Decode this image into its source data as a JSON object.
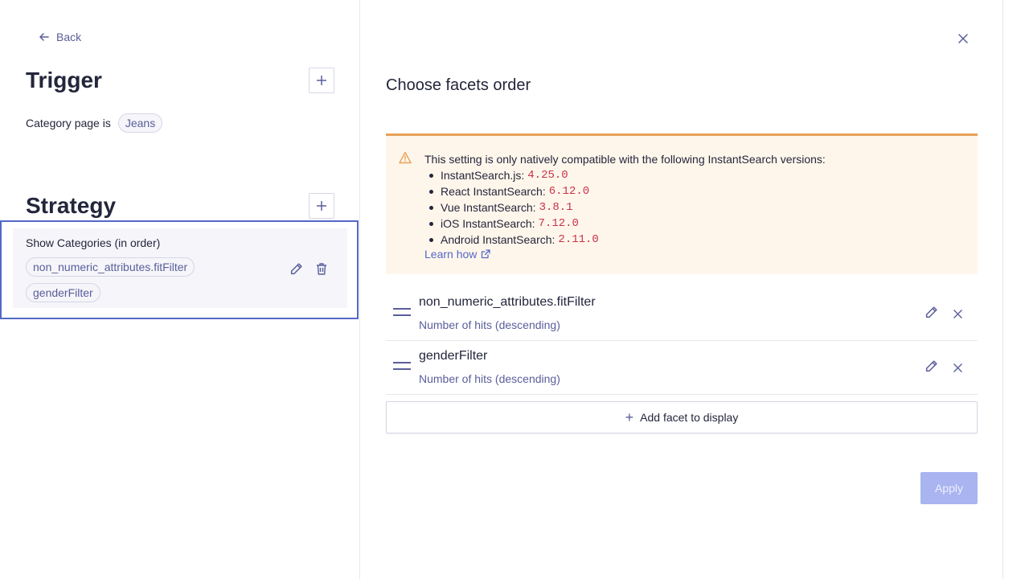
{
  "left": {
    "back_label": "Back",
    "trigger_title": "Trigger",
    "trigger_condition": "Category page is",
    "trigger_value": "Jeans",
    "strategy_title": "Strategy",
    "strategy_card": {
      "title": "Show Categories (in order)",
      "chips": [
        "non_numeric_attributes.fitFilter",
        "genderFilter"
      ]
    }
  },
  "panel": {
    "title": "Choose facets order",
    "warning": {
      "intro": "This setting is only natively compatible with the following InstantSearch versions:",
      "versions": [
        {
          "name": "InstantSearch.js:",
          "version": "4.25.0"
        },
        {
          "name": "React InstantSearch:",
          "version": "6.12.0"
        },
        {
          "name": "Vue InstantSearch:",
          "version": "3.8.1"
        },
        {
          "name": "iOS InstantSearch:",
          "version": "7.12.0"
        },
        {
          "name": "Android InstantSearch:",
          "version": "2.11.0"
        }
      ],
      "learn_how": "Learn how"
    },
    "facets": [
      {
        "name": "non_numeric_attributes.fitFilter",
        "sort": "Number of hits (descending)"
      },
      {
        "name": "genderFilter",
        "sort": "Number of hits (descending)"
      }
    ],
    "add_facet_label": "Add facet to display",
    "apply_label": "Apply"
  },
  "icons": {
    "back": "arrow-left-icon",
    "close": "close-icon",
    "warning": "warning-triangle-icon",
    "external": "external-link-icon",
    "edit": "pencil-icon",
    "delete": "trash-icon",
    "drag": "drag-handle-icon",
    "add": "plus-icon"
  },
  "colors": {
    "accent": "#5468c8",
    "warning_border": "#e8a157",
    "warning_bg": "#fff6eb",
    "version_code": "#c8334a",
    "apply_disabled": "#a9b4f0"
  }
}
